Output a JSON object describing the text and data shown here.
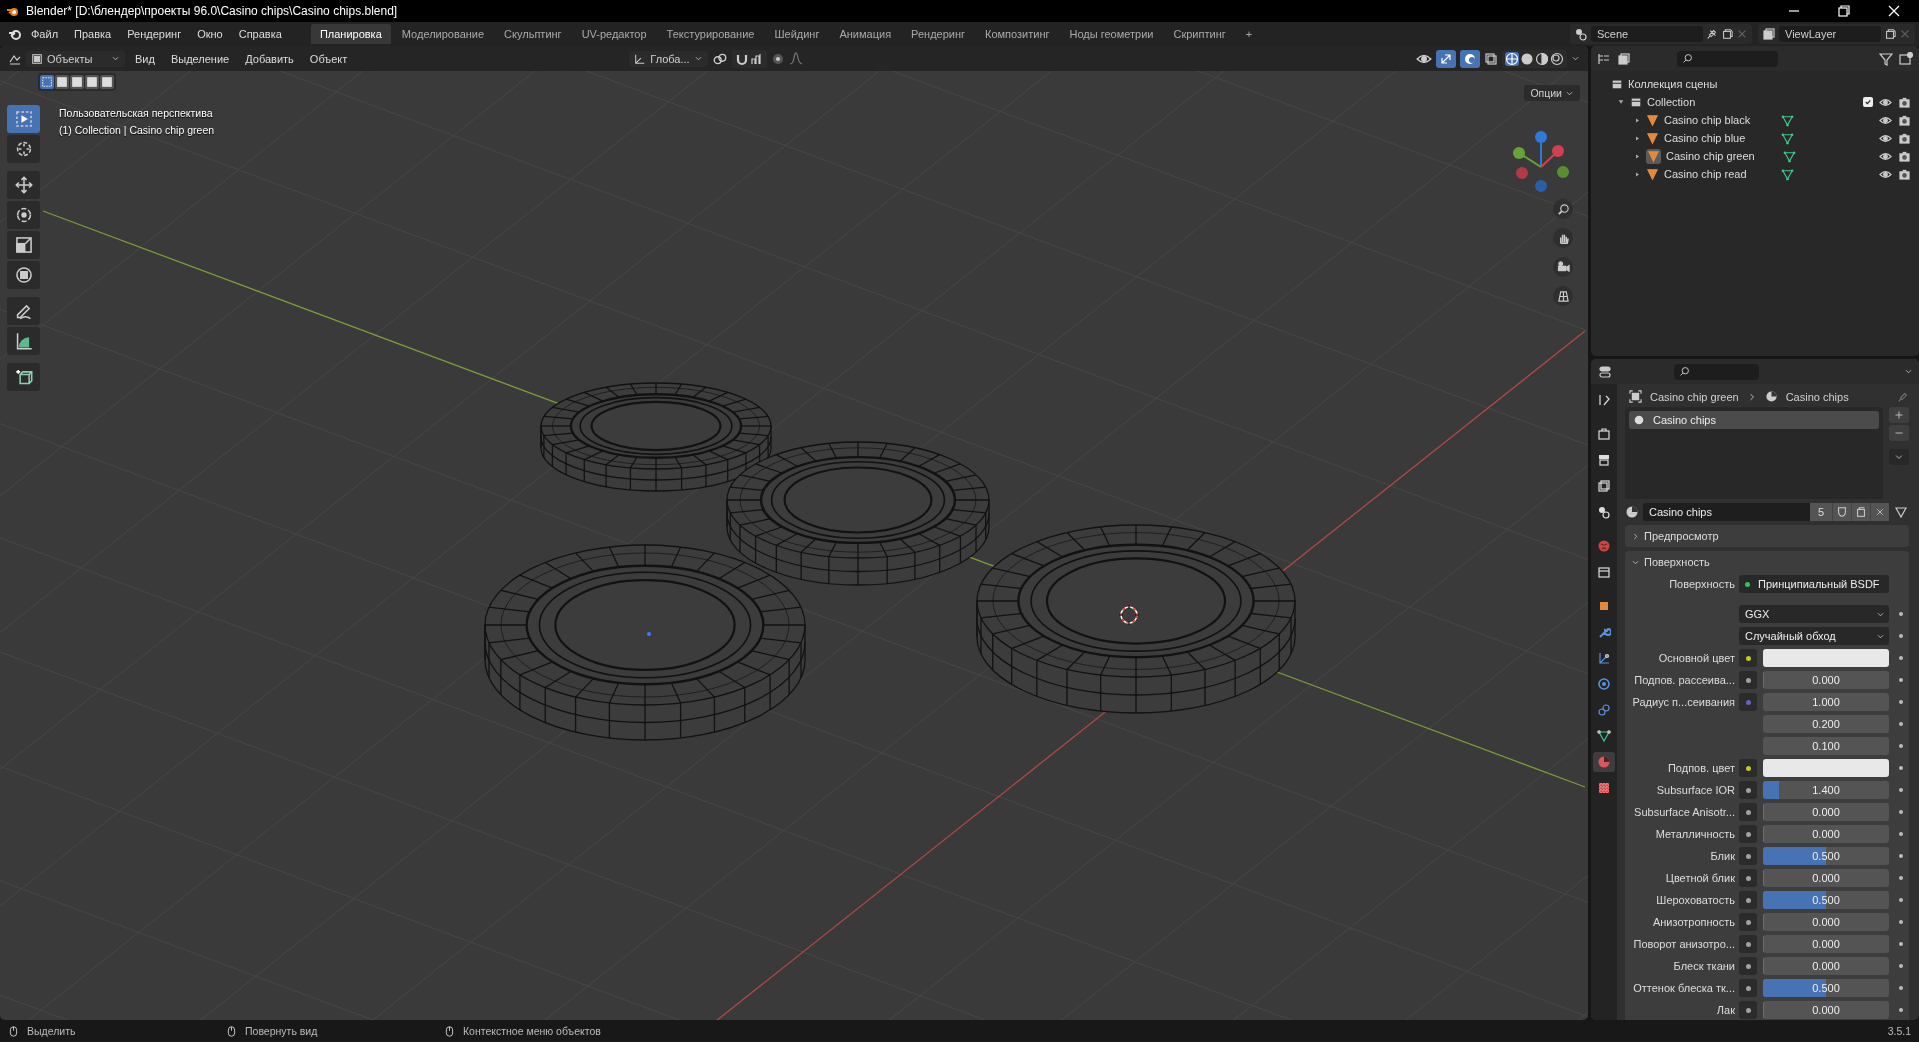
{
  "window": {
    "title": "Blender* [D:\\блендер\\проекты 96.0\\Casino chips\\Casino chips.blend]"
  },
  "menu": [
    "Файл",
    "Правка",
    "Рендеринг",
    "Окно",
    "Справка"
  ],
  "workspaces": [
    {
      "label": "Планировка",
      "selected": true
    },
    {
      "label": "Моделирование",
      "selected": false
    },
    {
      "label": "Скульптинг",
      "selected": false
    },
    {
      "label": "UV-редактор",
      "selected": false
    },
    {
      "label": "Текстурирование",
      "selected": false
    },
    {
      "label": "Шейдинг",
      "selected": false
    },
    {
      "label": "Анимация",
      "selected": false
    },
    {
      "label": "Рендеринг",
      "selected": false
    },
    {
      "label": "Композитинг",
      "selected": false
    },
    {
      "label": "Ноды геометрии",
      "selected": false
    },
    {
      "label": "Скриптинг",
      "selected": false
    }
  ],
  "add_workspace": "+",
  "scene": "Scene",
  "view_layer": "ViewLayer",
  "viewport_header": {
    "mode": "Объекты",
    "menus": [
      "Вид",
      "Выделение",
      "Добавить",
      "Объект"
    ],
    "orientation": "Глоба..."
  },
  "select_modes": [
    {
      "selected": true
    },
    {
      "selected": false
    },
    {
      "selected": false
    },
    {
      "selected": false
    },
    {
      "selected": false
    }
  ],
  "viewport": {
    "view_name": "Пользовательская перспектива",
    "active": "(1) Collection | Casino chip green",
    "options": "Опции"
  },
  "tools": [
    {
      "kind": "select",
      "selected": true
    },
    {
      "kind": "cursor",
      "selected": false
    },
    {
      "kind": "move",
      "selected": false
    },
    {
      "kind": "rotate",
      "selected": false
    },
    {
      "kind": "scale",
      "selected": false
    },
    {
      "kind": "transform",
      "selected": false
    },
    {
      "kind": "annotate",
      "selected": false
    },
    {
      "kind": "measure",
      "selected": false
    },
    {
      "kind": "add-cube",
      "selected": false
    }
  ],
  "outliner": {
    "scene_collection": "Коллекция сцены",
    "collection": {
      "name": "Collection",
      "expanded": true,
      "checked": true,
      "children": [
        {
          "name": "Casino chip black",
          "selected": false
        },
        {
          "name": "Casino chip blue",
          "selected": false
        },
        {
          "name": "Casino chip green",
          "selected": true
        },
        {
          "name": "Casino chip read",
          "selected": false
        }
      ]
    }
  },
  "property_tabs": [
    {
      "kind": "tool",
      "selected": false
    },
    {
      "kind": "render",
      "selected": false
    },
    {
      "kind": "output",
      "selected": false
    },
    {
      "kind": "view-layer",
      "selected": false
    },
    {
      "kind": "scene",
      "selected": false
    },
    {
      "kind": "world",
      "selected": false
    },
    {
      "kind": "collection",
      "selected": false
    },
    {
      "kind": "object",
      "selected": false
    },
    {
      "kind": "modifier",
      "selected": false
    },
    {
      "kind": "particles",
      "selected": false
    },
    {
      "kind": "physics",
      "selected": false
    },
    {
      "kind": "constraints",
      "selected": false
    },
    {
      "kind": "data",
      "selected": false
    },
    {
      "kind": "material",
      "selected": true
    },
    {
      "kind": "texture",
      "selected": false
    }
  ],
  "properties": {
    "breadcrumb": [
      "Casino chip green",
      "Casino chips"
    ],
    "slots": [
      {
        "name": "Casino chips",
        "selected": true
      }
    ],
    "material": "Casino chips",
    "users": "5",
    "panels": [
      {
        "title": "Предпросмотр",
        "expanded": false
      },
      {
        "title": "Поверхность",
        "expanded": true
      }
    ],
    "surface": {
      "label": "Поверхность",
      "value": "Принципиальный BSDF"
    },
    "dropdowns": [
      "GGX",
      "Случайный обход"
    ],
    "rows": [
      {
        "kind": "color",
        "label": "Основной цвет"
      },
      {
        "kind": "float",
        "label": "Подпов. рассеива...",
        "value": "0.000",
        "level": 0
      },
      {
        "kind": "vector",
        "label": "Радиус п...сеивания",
        "values": [
          "1.000",
          "0.200",
          "0.100"
        ]
      },
      {
        "kind": "color",
        "label": "Подпов. цвет"
      },
      {
        "kind": "float",
        "label": "Subsurface IOR",
        "value": "1.400",
        "level": 0.13
      },
      {
        "kind": "float",
        "label": "Subsurface Anisotr...",
        "value": "0.000",
        "level": 0
      },
      {
        "kind": "float",
        "label": "Металличность",
        "value": "0.000",
        "level": 0
      },
      {
        "kind": "float",
        "label": "Блик",
        "value": "0.500",
        "level": 0.5
      },
      {
        "kind": "float",
        "label": "Цветной блик",
        "value": "0.000",
        "level": 0
      },
      {
        "kind": "float",
        "label": "Шероховатость",
        "value": "0.500",
        "level": 0.5
      },
      {
        "kind": "float",
        "label": "Анизотропность",
        "value": "0.000",
        "level": 0
      },
      {
        "kind": "float",
        "label": "Поворот анизотро...",
        "value": "0.000",
        "level": 0
      },
      {
        "kind": "float",
        "label": "Блеск ткани",
        "value": "0.000",
        "level": 0
      },
      {
        "kind": "float",
        "label": "Оттенок блеска тк...",
        "value": "0.500",
        "level": 0.5
      },
      {
        "kind": "float",
        "label": "Лак",
        "value": "0.000",
        "level": 0
      }
    ]
  },
  "status_bar": {
    "hints": [
      "Выделить",
      "Повернуть вид",
      "Контекстное меню объектов"
    ],
    "version": "3.5.1"
  }
}
